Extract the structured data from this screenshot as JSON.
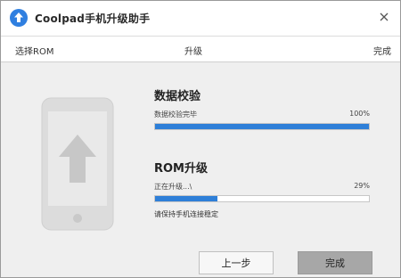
{
  "window": {
    "title": "Coolpad手机升级助手",
    "close_glyph": "×"
  },
  "steps": [
    {
      "label": "选择ROM"
    },
    {
      "label": "升级"
    },
    {
      "label": "完成"
    }
  ],
  "verify": {
    "title": "数据校验",
    "status": "数据校验完毕",
    "percent_text": "100%",
    "progress": 1.0
  },
  "upgrade": {
    "title": "ROM升级",
    "status": "正在升级...\\",
    "percent_text": "29%",
    "progress": 0.29,
    "note": "请保持手机连接稳定"
  },
  "buttons": {
    "prev": "上一步",
    "done": "完成"
  },
  "colors": {
    "accent": "#2e7fd8",
    "disabled_button": "#a7a7a7"
  },
  "icons": {
    "app": "upload-arrow-icon",
    "phone": "phone-upgrade-illustration",
    "close": "close-icon"
  }
}
